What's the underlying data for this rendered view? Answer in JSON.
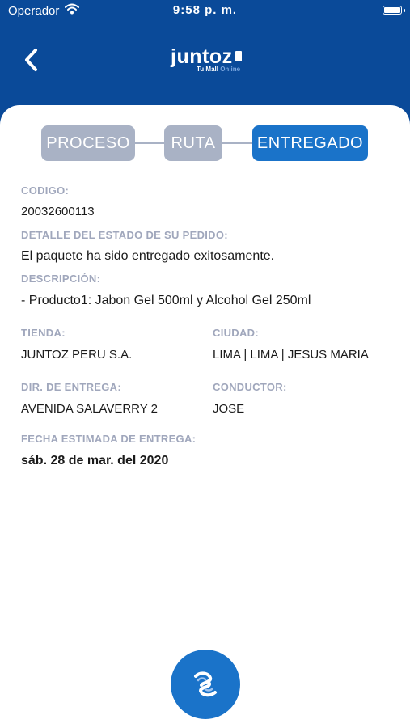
{
  "status_bar": {
    "carrier": "Operador",
    "time": "9:58 p. m."
  },
  "header": {
    "brand": {
      "name": "juntoz",
      "tagline": "Tu Mall",
      "tagline_accent": "Online"
    }
  },
  "stepper": {
    "steps": [
      {
        "label": "PROCESO",
        "state": "inactive"
      },
      {
        "label": "RUTA",
        "state": "inactive"
      },
      {
        "label": "ENTREGADO",
        "state": "active"
      }
    ]
  },
  "details": {
    "codigo": {
      "label": "CODIGO:",
      "value": "20032600113"
    },
    "detalle": {
      "label": "DETALLE DEL ESTADO DE SU PEDIDO:",
      "value": "El paquete ha sido entregado exitosamente."
    },
    "descripcion": {
      "label": "DESCRIPCIÓN:",
      "value": "- Producto1: Jabon Gel 500ml y Alcohol Gel 250ml"
    },
    "tienda": {
      "label": "TIENDA:",
      "value": "JUNTOZ PERU S.A."
    },
    "ciudad": {
      "label": "CIUDAD:",
      "value": "LIMA | LIMA | JESUS MARIA"
    },
    "dir_entrega": {
      "label": "DIR. DE ENTREGA:",
      "value": "AVENIDA SALAVERRY 2"
    },
    "conductor": {
      "label": "CONDUCTOR:",
      "value": "JOSE"
    },
    "fecha": {
      "label": "FECHA ESTIMADA DE ENTREGA:",
      "value": "sáb. 28 de mar. del 2020"
    }
  },
  "icons": {
    "back": "chevron-left-icon",
    "wifi": "wifi-icon",
    "battery": "battery-icon",
    "fab": "delivery-logo-icon"
  },
  "colors": {
    "header": "#0a4a99",
    "step_active": "#1a73c9",
    "step_inactive": "#a9b2c5",
    "label": "#a0a7bc",
    "fab": "#1a73c9"
  }
}
